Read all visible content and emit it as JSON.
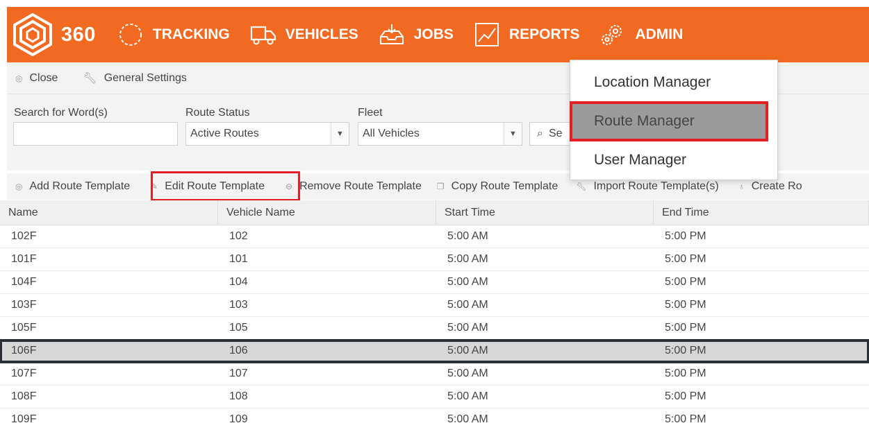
{
  "header": {
    "logo_text": "360",
    "nav": [
      {
        "label": "TRACKING",
        "icon": "tracking-circle-icon"
      },
      {
        "label": "VEHICLES",
        "icon": "truck-icon"
      },
      {
        "label": "JOBS",
        "icon": "inbox-tray-icon"
      },
      {
        "label": "REPORTS",
        "icon": "line-chart-icon"
      },
      {
        "label": "ADMIN",
        "icon": "gears-icon"
      }
    ]
  },
  "toolbar": {
    "close_label": "Close",
    "general_settings_label": "General Settings"
  },
  "filters": {
    "search_label": "Search for Word(s)",
    "search_value": "",
    "route_status_label": "Route Status",
    "route_status_value": "Active Routes",
    "fleet_label": "Fleet",
    "fleet_value": "All Vehicles",
    "search_button_label": "Se"
  },
  "actions": {
    "add": "Add Route Template",
    "edit": "Edit Route Template",
    "remove": "Remove Route Template",
    "copy": "Copy Route Template",
    "import": "Import Route Template(s)",
    "create": "Create Ro"
  },
  "table": {
    "columns": [
      "Name",
      "Vehicle Name",
      "Start Time",
      "End Time"
    ],
    "rows": [
      [
        "102F",
        "102",
        "5:00 AM",
        "5:00 PM"
      ],
      [
        "101F",
        "101",
        "5:00 AM",
        "5:00 PM"
      ],
      [
        "104F",
        "104",
        "5:00 AM",
        "5:00 PM"
      ],
      [
        "103F",
        "103",
        "5:00 AM",
        "5:00 PM"
      ],
      [
        "105F",
        "105",
        "5:00 AM",
        "5:00 PM"
      ],
      [
        "106F",
        "106",
        "5:00 AM",
        "5:00 PM"
      ],
      [
        "107F",
        "107",
        "5:00 AM",
        "5:00 PM"
      ],
      [
        "108F",
        "108",
        "5:00 AM",
        "5:00 PM"
      ],
      [
        "109F",
        "109",
        "5:00 AM",
        "5:00 PM"
      ]
    ],
    "selected_row": 5
  },
  "admin_menu": {
    "items": [
      "Location Manager",
      "Route Manager",
      "User Manager"
    ],
    "active_index": 1
  },
  "colors": {
    "brand_orange": "#f26a21",
    "highlight_red": "#e31e24",
    "selected_row_bg": "#d7d7d7"
  }
}
